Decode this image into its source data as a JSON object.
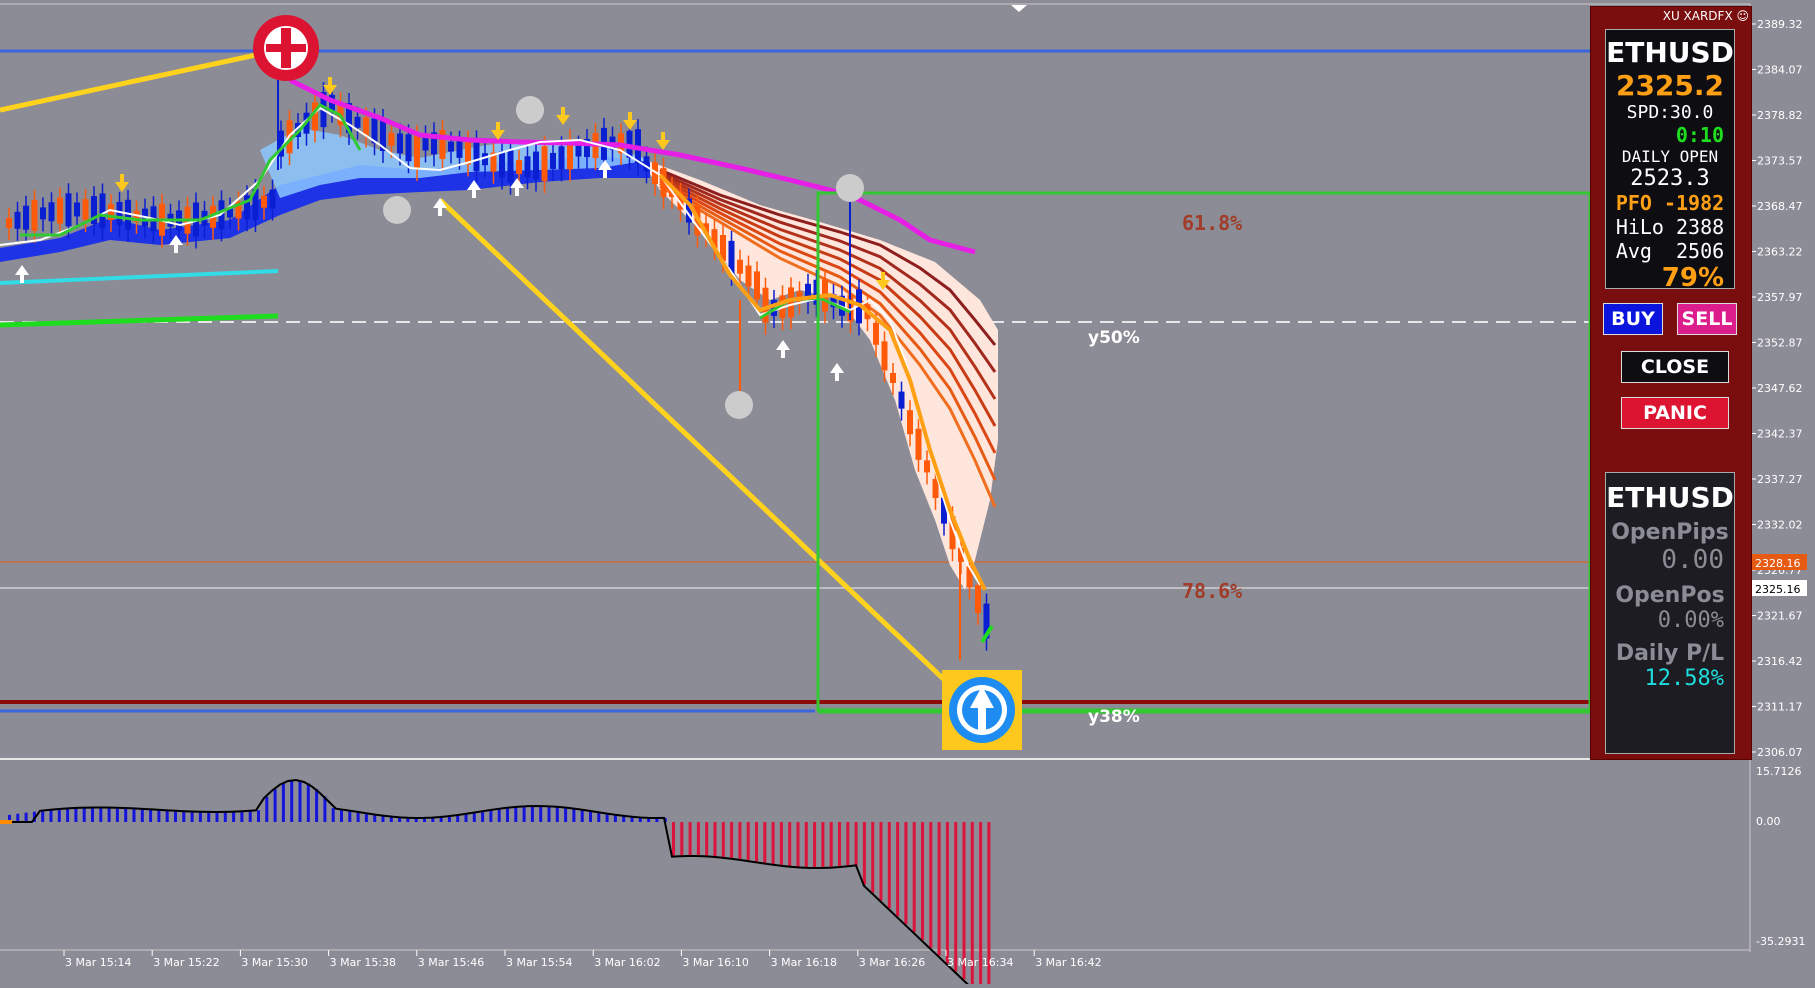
{
  "y_axis_ticks": [
    "2389.32",
    "2384.07",
    "2378.82",
    "2373.57",
    "2368.47",
    "2363.22",
    "2357.97",
    "2352.87",
    "2347.62",
    "2342.37",
    "2337.27",
    "2332.02",
    "2326.77",
    "2321.67",
    "2316.42",
    "2311.17",
    "2306.07"
  ],
  "price_tags": {
    "bid": "2325.16",
    "ask": "2328.16"
  },
  "x_axis_ticks": [
    "3 Mar 15:14",
    "3 Mar 15:22",
    "3 Mar 15:30",
    "3 Mar 15:38",
    "3 Mar 15:46",
    "3 Mar 15:54",
    "3 Mar 16:02",
    "3 Mar 16:10",
    "3 Mar 16:18",
    "3 Mar 16:26",
    "3 Mar 16:34",
    "3 Mar 16:42"
  ],
  "osc_axis_ticks": [
    "15.7126",
    "0.00",
    "-35.2931"
  ],
  "fib_labels": {
    "f618": "61.8%",
    "f786": "78.6%",
    "y50": "y50%",
    "y38": "y38%"
  },
  "panel": {
    "brand": "XU XARDFX",
    "symbol": "ETHUSD",
    "price": "2325.2",
    "spread": "SPD:30.0",
    "timer": "0:10",
    "daily_open_label": "DAILY OPEN",
    "daily_open_value": "2523.3",
    "pfo": "PFO -1982",
    "hilo": "HiLo 2388",
    "avg": "Avg  2506",
    "percent": "79%",
    "buy": "BUY",
    "sell": "SELL",
    "close": "CLOSE",
    "panic": "PANIC",
    "symbol2": "ETHUSD",
    "open_pips_label": "OpenPips",
    "open_pips_value": "0.00",
    "open_pos_label": "OpenPos",
    "open_pos_value": "0.00%",
    "daily_pl_label": "Daily P/L",
    "daily_pl_value": "12.58%"
  },
  "colors": {
    "bg": "#8c8c96",
    "bull": "#0a1ed2",
    "bear": "#ff5a0a",
    "ma": "#e61ee6",
    "fib_box": "#32c832",
    "trend": "#ffd21e",
    "osc_pos": "#1414dc",
    "osc_neg": "#dc143c"
  }
}
